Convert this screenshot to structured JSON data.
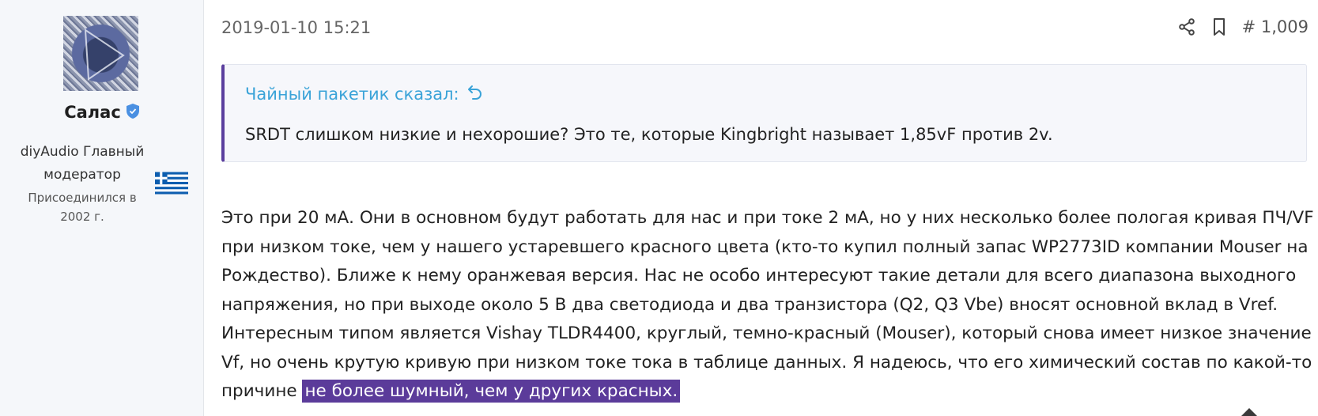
{
  "user": {
    "name": "Салас",
    "title": "diyAudio Главный модератор",
    "joined": "Присоединился в 2002 г.",
    "flag": "greece-flag",
    "verified_icon": "shield-check-icon"
  },
  "post": {
    "date": "2019-01-10 15:21",
    "number": "# 1,009",
    "actions": [
      "share-icon",
      "bookmark-icon"
    ],
    "quote": {
      "author_line": "Чайный пакетик сказал:",
      "text": "SRDT слишком низкие и нехорошие? Это те, которые Kingbright называет 1,85vF против 2v."
    },
    "body_main": "Это при 20 мА. Они в основном будут работать для нас и при токе 2 мА, но у них несколько более пологая кривая ПЧ/VF при низком токе, чем у нашего устаревшего красного цвета (кто-то купил полный запас WP2773ID компании Mouser на Рождество). Ближе к нему оранжевая версия. Нас не особо интересуют такие детали для всего диапазона выходного напряжения, но при выходе около 5 В два светодиода и два транзистора (Q2, Q3 Vbe) вносят основной вклад в Vref. Интересным типом является Vishay TLDR4400, круглый, темно-красный (Mouser), который снова имеет низкое значение Vf, но очень крутую кривую при низком токе тока в таблице данных. Я надеюсь, что его химический состав по какой-то причине ",
    "body_highlight": "не более шумный, чем у других красных."
  },
  "colors": {
    "accent_quote_border": "#5b3f9e",
    "quote_link": "#3aa3d8",
    "highlight_bg": "#5b3b9a",
    "verified": "#4a90e2"
  }
}
